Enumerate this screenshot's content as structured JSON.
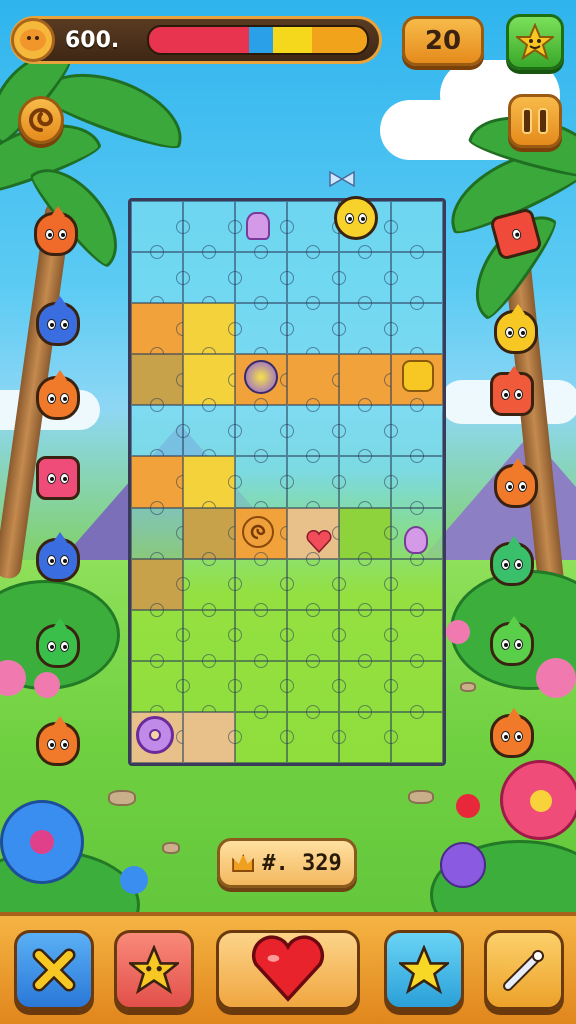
{
  "hud": {
    "score": "600.",
    "level": "20",
    "meter": {
      "segments": [
        {
          "color": "#e8344e",
          "fraction": 0.46
        },
        {
          "color": "#2aa0e8",
          "fraction": 0.11
        },
        {
          "color": "#f5d81c",
          "fraction": 0.18
        },
        {
          "color": "#f1a31b",
          "fraction": 0.25
        }
      ]
    }
  },
  "board": {
    "cols": 6,
    "rows": 11
  },
  "bonus": {
    "text": "#. 329"
  },
  "icons": {
    "avatar": "monster-face-icon",
    "star_top": "star-face-icon",
    "swirl": "swirl-icon",
    "pause": "pause-icon",
    "bottom": [
      "cross-icon",
      "star-face-icon",
      "heart-icon",
      "star-icon",
      "wand-icon"
    ]
  },
  "colors": {
    "accent": "#f2a23a",
    "frame": "#e8a33a",
    "heart": "#e8232c"
  }
}
